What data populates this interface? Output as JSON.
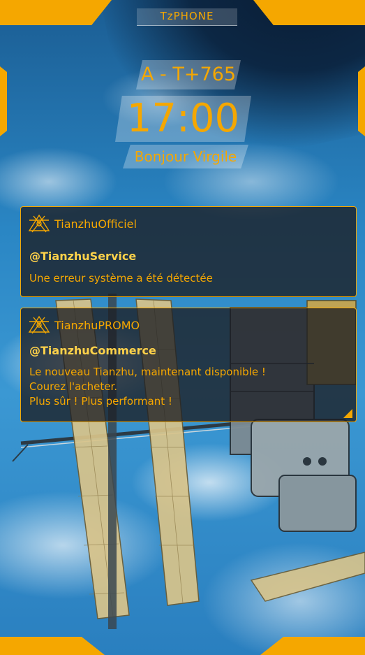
{
  "header": {
    "brand": "TzPHONE"
  },
  "lockscreen": {
    "code": "A - T+765",
    "time": "17:00",
    "greeting": "Bonjour Virgile"
  },
  "notifications": [
    {
      "app": "TianzhuOfficiel",
      "sender": "@TianzhuService",
      "body": "Une erreur système a été détectée",
      "icon": "tianzhu-logo-icon"
    },
    {
      "app": "TianzhuPROMO",
      "sender": "@TianzhuCommerce",
      "body": "Le nouveau Tianzhu, maintenant disponible !\nCourez l'acheter.\nPlus sûr ! Plus performant !",
      "icon": "tianzhu-logo-icon"
    }
  ],
  "colors": {
    "accent": "#f5a700",
    "sender": "#ffd24a",
    "panel": "#1c1e22"
  }
}
